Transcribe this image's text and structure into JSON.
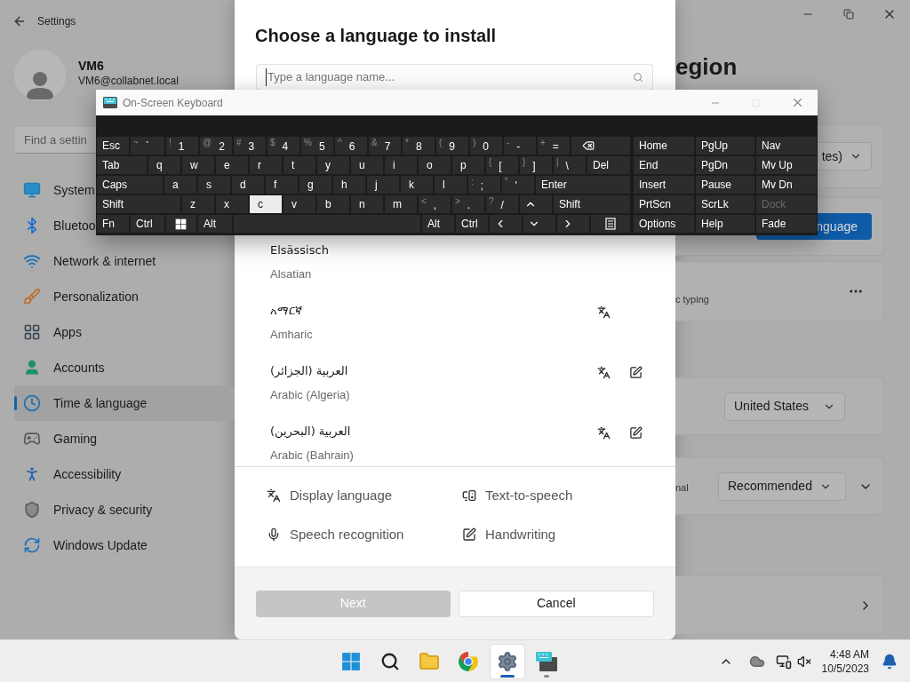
{
  "settings": {
    "title": "Settings",
    "user": {
      "name": "VM6",
      "email": "VM6@collabnet.local"
    },
    "search": {
      "placeholder": "Find a settin"
    },
    "nav": [
      {
        "label": "System",
        "selected": false
      },
      {
        "label": "Bluetoo",
        "selected": false
      },
      {
        "label": "Network & internet",
        "selected": false
      },
      {
        "label": "Personalization",
        "selected": false
      },
      {
        "label": "Apps",
        "selected": false
      },
      {
        "label": "Accounts",
        "selected": false
      },
      {
        "label": "Time & language",
        "selected": true
      },
      {
        "label": "Gaming",
        "selected": false
      },
      {
        "label": "Accessibility",
        "selected": false
      },
      {
        "label": "Privacy & security",
        "selected": false
      },
      {
        "label": "Windows Update",
        "selected": false
      }
    ],
    "page_title": "egion",
    "region_dropdown": "tes)",
    "add_button": "nguage",
    "typing_note": "c typing",
    "country_dropdown": "United States",
    "regional_note": "nal",
    "format_dropdown": "Recommended"
  },
  "dialog": {
    "title": "Choose a language to install",
    "search": {
      "placeholder": "Type a language name..."
    },
    "languages": [
      {
        "native": "Elsässisch",
        "english": "Alsatian",
        "display": false,
        "handwriting": false
      },
      {
        "native": "አማርኛ",
        "english": "Amharic",
        "display": true,
        "handwriting": false
      },
      {
        "native": "العربية (الجزائر)",
        "english": "Arabic (Algeria)",
        "display": true,
        "handwriting": true
      },
      {
        "native": "العربية (البحرين)",
        "english": "Arabic (Bahrain)",
        "display": true,
        "handwriting": true
      }
    ],
    "legend": [
      {
        "kind": "display",
        "label": "Display language"
      },
      {
        "kind": "tts",
        "label": "Text-to-speech"
      },
      {
        "kind": "speech",
        "label": "Speech recognition"
      },
      {
        "kind": "handwriting",
        "label": "Handwriting"
      }
    ],
    "buttons": [
      {
        "label": "Next",
        "disabled": true
      },
      {
        "label": "Cancel",
        "disabled": false
      }
    ]
  },
  "keyboard": {
    "title": "On-Screen Keyboard",
    "main_rows": [
      [
        {
          "kind": "text",
          "label": "Esc",
          "pressed": false
        },
        {
          "kind": "dual",
          "shift": "~",
          "label": "`",
          "pressed": false
        },
        {
          "kind": "dual",
          "shift": "!",
          "label": "1",
          "pressed": false
        },
        {
          "kind": "dual",
          "shift": "@",
          "label": "2",
          "pressed": false
        },
        {
          "kind": "dual",
          "shift": "#",
          "label": "3",
          "pressed": false
        },
        {
          "kind": "dual",
          "shift": "$",
          "label": "4",
          "pressed": false
        },
        {
          "kind": "dual",
          "shift": "%",
          "label": "5",
          "pressed": false
        },
        {
          "kind": "dual",
          "shift": "^",
          "label": "6",
          "pressed": false
        },
        {
          "kind": "dual",
          "shift": "&",
          "label": "7",
          "pressed": false
        },
        {
          "kind": "dual",
          "shift": "*",
          "label": "8",
          "pressed": false
        },
        {
          "kind": "dual",
          "shift": "(",
          "label": "9",
          "pressed": false
        },
        {
          "kind": "dual",
          "shift": ")",
          "label": "0",
          "pressed": false
        },
        {
          "kind": "dual",
          "shift": "-",
          "label": "-",
          "pressed": false
        },
        {
          "kind": "dual",
          "shift": "+",
          "label": "=",
          "pressed": false
        },
        {
          "kind": "backspace",
          "pressed": false
        }
      ],
      [
        {
          "kind": "text",
          "label": "Tab",
          "pressed": false
        },
        {
          "kind": "letter",
          "label": "q",
          "pressed": false
        },
        {
          "kind": "letter",
          "label": "w",
          "pressed": false
        },
        {
          "kind": "letter",
          "label": "e",
          "pressed": false
        },
        {
          "kind": "letter",
          "label": "r",
          "pressed": false
        },
        {
          "kind": "letter",
          "label": "t",
          "pressed": false
        },
        {
          "kind": "letter",
          "label": "y",
          "pressed": false
        },
        {
          "kind": "letter",
          "label": "u",
          "pressed": false
        },
        {
          "kind": "letter",
          "label": "i",
          "pressed": false
        },
        {
          "kind": "letter",
          "label": "o",
          "pressed": false
        },
        {
          "kind": "letter",
          "label": "p",
          "pressed": false
        },
        {
          "kind": "dual",
          "shift": "{",
          "label": "[",
          "pressed": false
        },
        {
          "kind": "dual",
          "shift": "}",
          "label": "]",
          "pressed": false
        },
        {
          "kind": "dual",
          "shift": "|",
          "label": "\\",
          "pressed": false
        },
        {
          "kind": "text",
          "label": "Del",
          "pressed": false
        }
      ],
      [
        {
          "kind": "text",
          "label": "Caps",
          "pressed": false
        },
        {
          "kind": "letter",
          "label": "a",
          "pressed": false
        },
        {
          "kind": "letter",
          "label": "s",
          "pressed": false
        },
        {
          "kind": "letter",
          "label": "d",
          "pressed": false
        },
        {
          "kind": "letter",
          "label": "f",
          "pressed": false
        },
        {
          "kind": "letter",
          "label": "g",
          "pressed": false
        },
        {
          "kind": "letter",
          "label": "h",
          "pressed": false
        },
        {
          "kind": "letter",
          "label": "j",
          "pressed": false
        },
        {
          "kind": "letter",
          "label": "k",
          "pressed": false
        },
        {
          "kind": "letter",
          "label": "l",
          "pressed": false
        },
        {
          "kind": "dual",
          "shift": ":",
          "label": ";",
          "pressed": false
        },
        {
          "kind": "dual",
          "shift": "\"",
          "label": "'",
          "pressed": false
        },
        {
          "kind": "text",
          "label": "Enter",
          "pressed": false
        }
      ],
      [
        {
          "kind": "text",
          "label": "Shift",
          "pressed": false
        },
        {
          "kind": "letter",
          "label": "z",
          "pressed": false
        },
        {
          "kind": "letter",
          "label": "x",
          "pressed": false
        },
        {
          "kind": "letter",
          "label": "c",
          "pressed": true
        },
        {
          "kind": "letter",
          "label": "v",
          "pressed": false
        },
        {
          "kind": "letter",
          "label": "b",
          "pressed": false
        },
        {
          "kind": "letter",
          "label": "n",
          "pressed": false
        },
        {
          "kind": "letter",
          "label": "m",
          "pressed": false
        },
        {
          "kind": "dual",
          "shift": "<",
          "label": ",",
          "pressed": false
        },
        {
          "kind": "dual",
          "shift": ">",
          "label": ".",
          "pressed": false
        },
        {
          "kind": "dual",
          "shift": "?",
          "label": "/",
          "pressed": false
        },
        {
          "kind": "up",
          "pressed": false
        },
        {
          "kind": "text",
          "label": "Shift",
          "pressed": false
        }
      ],
      [
        {
          "kind": "text",
          "label": "Fn",
          "pressed": false
        },
        {
          "kind": "text",
          "label": "Ctrl",
          "pressed": false
        },
        {
          "kind": "windows",
          "pressed": false
        },
        {
          "kind": "text",
          "label": "Alt",
          "pressed": false
        },
        {
          "kind": "space",
          "pressed": false
        },
        {
          "kind": "text",
          "label": "Alt",
          "pressed": false
        },
        {
          "kind": "text",
          "label": "Ctrl",
          "pressed": false
        },
        {
          "kind": "left",
          "pressed": false
        },
        {
          "kind": "down",
          "pressed": false
        },
        {
          "kind": "right",
          "pressed": false
        },
        {
          "kind": "menu",
          "pressed": false
        }
      ]
    ],
    "side_rows": [
      [
        {
          "label": "Home",
          "disabled": false
        },
        {
          "label": "PgUp",
          "disabled": false
        },
        {
          "label": "Nav",
          "disabled": false
        }
      ],
      [
        {
          "label": "End",
          "disabled": false
        },
        {
          "label": "PgDn",
          "disabled": false
        },
        {
          "label": "Mv Up",
          "disabled": false
        }
      ],
      [
        {
          "label": "Insert",
          "disabled": false
        },
        {
          "label": "Pause",
          "disabled": false
        },
        {
          "label": "Mv Dn",
          "disabled": false
        }
      ],
      [
        {
          "label": "PrtScn",
          "disabled": false
        },
        {
          "label": "ScrLk",
          "disabled": false
        },
        {
          "label": "Dock",
          "disabled": true
        }
      ],
      [
        {
          "label": "Options",
          "disabled": false
        },
        {
          "label": "Help",
          "disabled": false
        },
        {
          "label": "Fade",
          "disabled": false
        }
      ]
    ]
  },
  "taskbar": {
    "apps": [
      {
        "kind": "start",
        "active": false,
        "running": false
      },
      {
        "kind": "search",
        "active": false,
        "running": false
      },
      {
        "kind": "files",
        "active": false,
        "running": false
      },
      {
        "kind": "browser",
        "active": false,
        "running": false
      },
      {
        "kind": "settings",
        "active": true,
        "running": true
      },
      {
        "kind": "keyboard",
        "active": false,
        "running": true
      }
    ],
    "clock": {
      "time": "4:48 AM",
      "date": "10/5/2023"
    }
  }
}
